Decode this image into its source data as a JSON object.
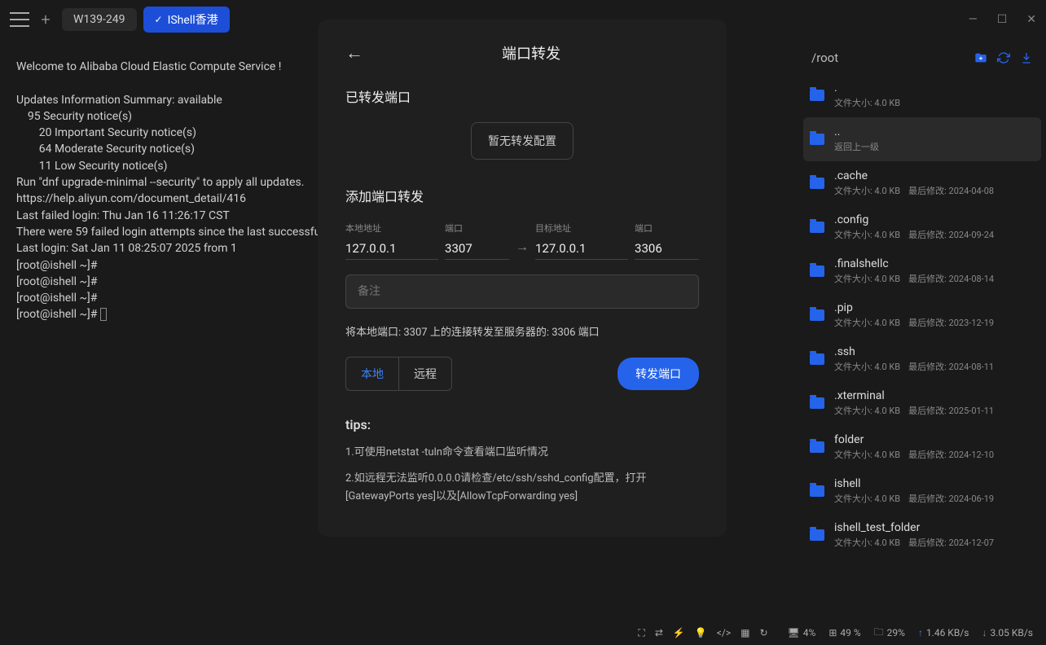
{
  "tabs": {
    "tab1": "W139-249",
    "tab2": "IShell香港"
  },
  "terminal": "Welcome to Alibaba Cloud Elastic Compute Service !\n\nUpdates Information Summary: available\n    95 Security notice(s)\n        20 Important Security notice(s)\n        64 Moderate Security notice(s)\n        11 Low Security notice(s)\nRun \"dnf upgrade-minimal --security\" to apply all updates.\nhttps://help.aliyun.com/document_detail/416\nLast failed login: Thu Jan 16 11:26:17 CST\nThere were 59 failed login attempts since the last successful login.\nLast login: Sat Jan 11 08:25:07 2025 from 1\n[root@ishell ~]#\n[root@ishell ~]#\n[root@ishell ~]#\n[root@ishell ~]# ",
  "files": {
    "path": "/root",
    "items": [
      {
        "name": ".",
        "size": "文件大小: 4.0 KB",
        "mod": ""
      },
      {
        "name": "..",
        "size": "返回上一级",
        "mod": ""
      },
      {
        "name": ".cache",
        "size": "文件大小: 4.0 KB",
        "mod": "最后修改: 2024-04-08"
      },
      {
        "name": ".config",
        "size": "文件大小: 4.0 KB",
        "mod": "最后修改: 2024-09-24"
      },
      {
        "name": ".finalshellc",
        "size": "文件大小: 4.0 KB",
        "mod": "最后修改: 2024-08-14"
      },
      {
        "name": ".pip",
        "size": "文件大小: 4.0 KB",
        "mod": "最后修改: 2023-12-19"
      },
      {
        "name": ".ssh",
        "size": "文件大小: 4.0 KB",
        "mod": "最后修改: 2024-08-11"
      },
      {
        "name": ".xterminal",
        "size": "文件大小: 4.0 KB",
        "mod": "最后修改: 2025-01-11"
      },
      {
        "name": "folder",
        "size": "文件大小: 4.0 KB",
        "mod": "最后修改: 2024-12-10"
      },
      {
        "name": "ishell",
        "size": "文件大小: 4.0 KB",
        "mod": "最后修改: 2024-06-19"
      },
      {
        "name": "ishell_test_folder",
        "size": "文件大小: 4.0 KB",
        "mod": "最后修改: 2024-12-07"
      }
    ]
  },
  "modal": {
    "title": "端口转发",
    "section_forwarded": "已转发端口",
    "empty": "暂无转发配置",
    "section_add": "添加端口转发",
    "local_addr_label": "本地地址",
    "local_addr": "127.0.0.1",
    "local_port_label": "端口",
    "local_port": "3307",
    "target_addr_label": "目标地址",
    "target_addr": "127.0.0.1",
    "target_port_label": "端口",
    "target_port": "3306",
    "note_placeholder": "备注",
    "desc": "将本地端口: 3307 上的连接转发至服务器的: 3306 端口",
    "seg_local": "本地",
    "seg_remote": "远程",
    "forward_btn": "转发端口",
    "tips_title": "tips:",
    "tip1": "1.可使用netstat -tuln命令查看端口监听情况",
    "tip2": "2.如远程无法监听0.0.0.0请检查/etc/ssh/sshd_config配置，打开[GatewayPorts yes]以及[AllowTcpForwarding yes]"
  },
  "status": {
    "cpu": "4%",
    "mem": "49 %",
    "disk": "29%",
    "up": "1.46 KB/s",
    "down": "3.05 KB/s"
  }
}
